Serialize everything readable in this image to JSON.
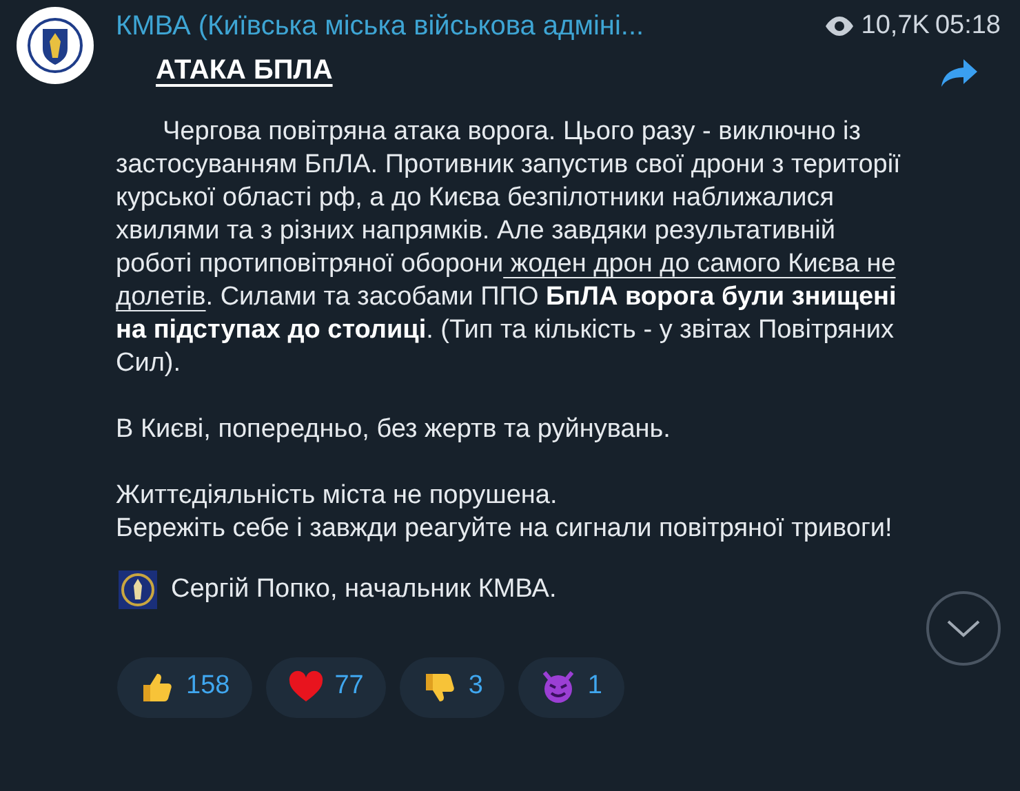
{
  "channel": {
    "name": "КМВА (Київська міська військова адміні...",
    "views": "10,7K",
    "time": "05:18"
  },
  "post": {
    "title": "АТАКА БПЛА",
    "paragraph": [
      {
        "kind": "plain",
        "text": "Чергова повітряна атака ворога. Цього разу - виключно із застосуванням БпЛА. Противник запустив свої дрони з території курської області рф, а до Києва безпілотники наближалися хвилями та з різних напрямків. Але завдяки результативній роботі протиповітряної оборони"
      },
      {
        "kind": "underline",
        "text": " жоден дрон до самого Києва не долетів"
      },
      {
        "kind": "plain",
        "text": ". Силами та засобами ППО "
      },
      {
        "kind": "bold",
        "text": "БпЛА ворога були знищені на підступах до столиці"
      },
      {
        "kind": "plain",
        "text": ". (Тип та кількість - у звітах Повітряних Сил)."
      }
    ],
    "lines": [
      "В Києві, попередньо, без жертв та руйнувань.",
      "Життєдіяльність міста не порушена.",
      "Бережіть себе і завжди реагуйте на сигнали повітряної тривоги!"
    ],
    "signature": "Сергій Попко, начальник КМВА."
  },
  "reactions": [
    {
      "kind": "thumbs-up",
      "count": "158"
    },
    {
      "kind": "heart",
      "count": "77"
    },
    {
      "kind": "thumbs-down",
      "count": "3"
    },
    {
      "kind": "devil",
      "count": "1"
    }
  ]
}
